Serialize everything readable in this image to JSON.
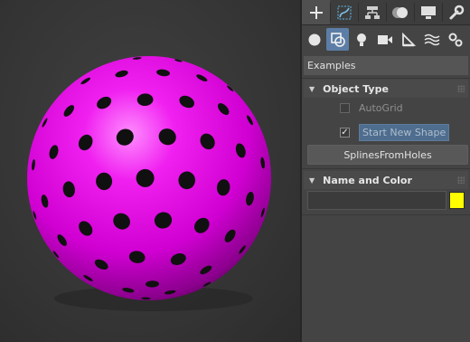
{
  "viewport": {
    "object_color": "#e400e6",
    "background": "#333333"
  },
  "command_panel": {
    "tabs": [
      {
        "icon": "plus-icon",
        "label": "Create",
        "active": true
      },
      {
        "icon": "modify-icon",
        "label": "Modify"
      },
      {
        "icon": "hierarchy-icon",
        "label": "Hierarchy"
      },
      {
        "icon": "motion-icon",
        "label": "Motion"
      },
      {
        "icon": "display-icon",
        "label": "Display"
      },
      {
        "icon": "wrench-icon",
        "label": "Utilities"
      }
    ],
    "categories": [
      {
        "icon": "sphere-icon",
        "label": "Geometry"
      },
      {
        "icon": "shapes-icon",
        "label": "Shapes",
        "active": true
      },
      {
        "icon": "light-bulb-icon",
        "label": "Lights"
      },
      {
        "icon": "camera-icon",
        "label": "Cameras"
      },
      {
        "icon": "ruler-triangle-icon",
        "label": "Helpers"
      },
      {
        "icon": "space-warps-icon",
        "label": "Space Warps"
      },
      {
        "icon": "systems-gears-icon",
        "label": "Systems"
      }
    ],
    "category_dropdown": "Examples",
    "object_type": {
      "title": "Object Type",
      "autogrid_label": "AutoGrid",
      "start_new_shape_label": "Start New Shape",
      "start_new_shape_checked": true,
      "button_label": "SplinesFromHoles"
    },
    "name_and_color": {
      "title": "Name and Color",
      "name_value": "",
      "color": "#ffff00"
    }
  }
}
